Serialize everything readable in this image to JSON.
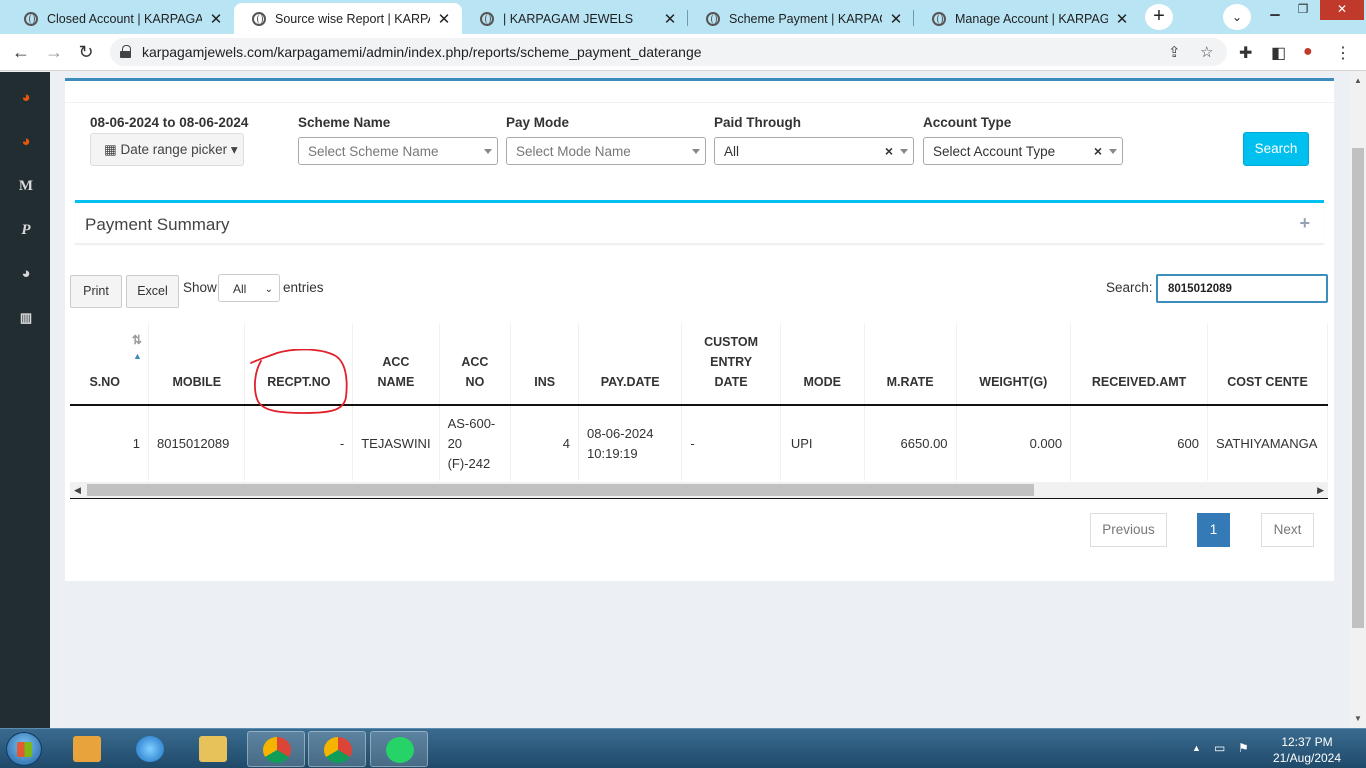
{
  "browser": {
    "tabs": [
      {
        "title": "Closed Account | KARPAGAM J",
        "active": false
      },
      {
        "title": "Source wise Report | KARPAGA",
        "active": true
      },
      {
        "title": "| KARPAGAM JEWELS",
        "active": false
      },
      {
        "title": "Scheme Payment | KARPAGAM",
        "active": false
      },
      {
        "title": "Manage Account | KARPAGAM",
        "active": false
      }
    ],
    "url": "karpagamjewels.com/karpagamemi/admin/index.php/reports/scheme_payment_daterange"
  },
  "filters": {
    "date_range_text": "08-06-2024 to 08-06-2024",
    "date_picker_label": "Date range picker",
    "scheme_label": "Scheme Name",
    "scheme_placeholder": "Select Scheme Name",
    "paymode_label": "Pay Mode",
    "paymode_placeholder": "Select Mode Name",
    "paid_through_label": "Paid Through",
    "paid_through_value": "All",
    "account_type_label": "Account Type",
    "account_type_placeholder": "Select Account Type",
    "search_button": "Search"
  },
  "summary": {
    "title": "Payment Summary",
    "toggle": "+"
  },
  "datatable": {
    "print_label": "Print",
    "excel_label": "Excel",
    "show_label": "Show",
    "entries_label": "entries",
    "length_value": "All",
    "search_label": "Search:",
    "search_value": "8015012089",
    "columns": [
      "S.NO",
      "MOBILE",
      "RECPT.NO",
      "ACC NAME",
      "ACC NO",
      "INS",
      "PAY.DATE",
      "CUSTOM ENTRY DATE",
      "MODE",
      "M.RATE",
      "WEIGHT(G)",
      "RECEIVED.AMT",
      "COST CENTE"
    ],
    "rows": [
      {
        "sno": "1",
        "mobile": "8015012089",
        "recpt_no": "-",
        "acc_name": "TEJASWINI",
        "acc_no": "AS-600-20 (F)-242",
        "ins": "4",
        "pay_date": "08-06-2024 10:19:19",
        "custom_entry_date": "-",
        "mode": "UPI",
        "m_rate": "6650.00",
        "weight": "0.000",
        "received_amt": "600",
        "cost_center": "SATHIYAMANGA"
      }
    ]
  },
  "pagination": {
    "previous": "Previous",
    "current": "1",
    "next": "Next"
  },
  "taskbar": {
    "time": "12:37 PM",
    "date": "21/Aug/2024"
  },
  "colors": {
    "accent": "#3c8dbc",
    "info": "#00c0ef",
    "sidebar": "#222d32",
    "annotation": "#e0202a"
  }
}
